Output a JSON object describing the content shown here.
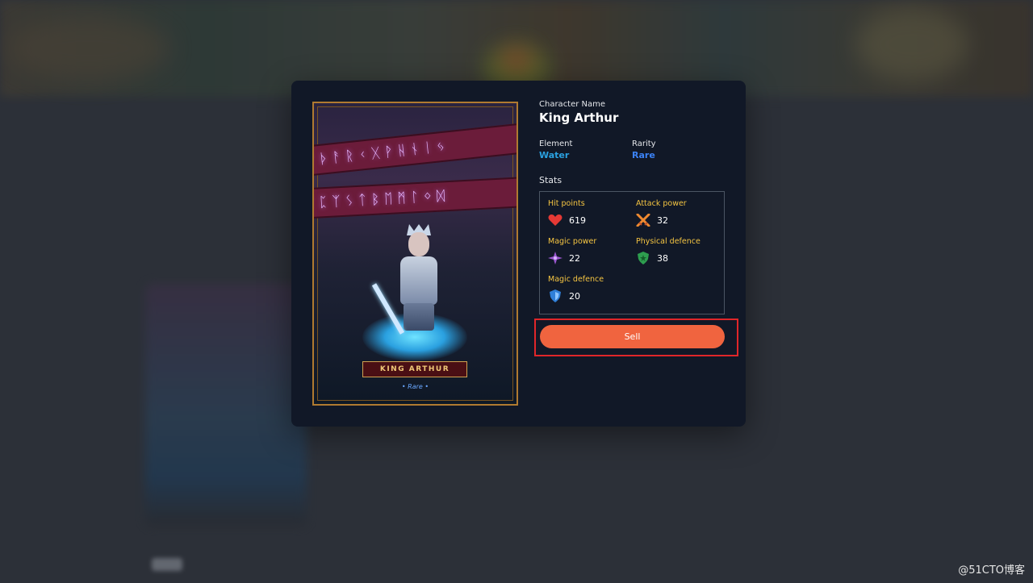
{
  "character": {
    "name_label": "Character Name",
    "name": "King Arthur",
    "element_label": "Element",
    "element": "Water",
    "rarity_label": "Rarity",
    "rarity": "Rare",
    "accent_color": "#2f80ed"
  },
  "card": {
    "plate_text": "KING ARTHUR",
    "rarity_text": "• Rare •",
    "banner_row_1": "ᚠᚦᚨᚱᚲᚷᚹᚺᚾᛁᛃ",
    "banner_row_2": "ᛇᛈᛉᛊᛏᛒᛖᛗᛚᛜᛞ"
  },
  "stats": {
    "title": "Stats",
    "items": [
      {
        "label": "Hit points",
        "value": "619",
        "icon": "heart-icon"
      },
      {
        "label": "Attack power",
        "value": "32",
        "icon": "crossed-swords-icon"
      },
      {
        "label": "Magic power",
        "value": "22",
        "icon": "magic-star-icon"
      },
      {
        "label": "Physical defence",
        "value": "38",
        "icon": "green-shield-icon"
      },
      {
        "label": "Magic defence",
        "value": "20",
        "icon": "blue-shield-icon"
      }
    ]
  },
  "actions": {
    "sell_label": "Sell",
    "sell_color": "#f0643f"
  },
  "watermark": "@51CTO博客"
}
